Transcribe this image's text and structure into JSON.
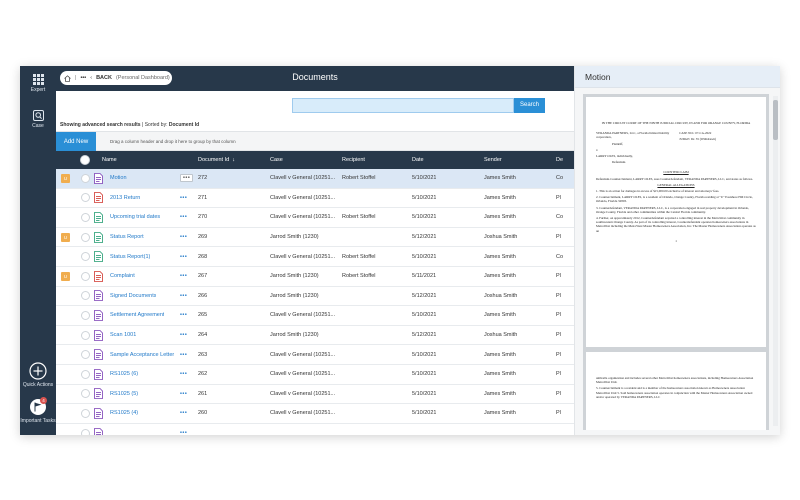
{
  "rail": {
    "expert_label": "Expert",
    "case_label": "Case",
    "quick_actions_label": "Quick Actions",
    "important_tasks_label": "Important Tasks",
    "important_tasks_count": "4"
  },
  "header": {
    "back_label": "BACK",
    "back_sub": "(Personal Dashboard)",
    "title": "Documents"
  },
  "search": {
    "placeholder": "",
    "button_label": "Search"
  },
  "info": {
    "showing": "Showing advanced search results",
    "sorted_by_label": "Sorted by:",
    "sorted_by_value": "Document Id"
  },
  "toolbar": {
    "add_new_label": "Add New",
    "drag_hint": "Drag a column header and drop it here to group by that column"
  },
  "grid": {
    "columns": [
      "Name",
      "Document Id",
      "Case",
      "Recipient",
      "Date",
      "Sender",
      "De"
    ],
    "sort_indicator": "↓",
    "rows": [
      {
        "flag": "U",
        "name": "Motion",
        "id": "272",
        "case": "Clavell v General (10251...",
        "recipient": "Robert Stoffel",
        "date": "5/10/2021",
        "sender": "James Smith",
        "de": "Co",
        "icon": "word",
        "selected": true
      },
      {
        "flag": "",
        "name": "2013 Return",
        "id": "271",
        "case": "Clavell v General (10251...",
        "recipient": "",
        "date": "5/10/2021",
        "sender": "James Smith",
        "de": "Pl",
        "icon": "pdf"
      },
      {
        "flag": "",
        "name": "Upcoming trial dates",
        "id": "270",
        "case": "Clavell v General (10251...",
        "recipient": "Robert Stoffel",
        "date": "5/10/2021",
        "sender": "James Smith",
        "de": "Co",
        "icon": "excel"
      },
      {
        "flag": "U",
        "name": "Status Report",
        "id": "269",
        "case": "Jarrod Smith (1230)",
        "recipient": "",
        "date": "5/12/2021",
        "sender": "Joshua Smith",
        "de": "Pl",
        "icon": "excel"
      },
      {
        "flag": "",
        "name": "Status Report(1)",
        "id": "268",
        "case": "Clavell v General (10251...",
        "recipient": "Robert Stoffel",
        "date": "5/10/2021",
        "sender": "James Smith",
        "de": "Co",
        "icon": "excel"
      },
      {
        "flag": "U",
        "name": "Complaint",
        "id": "267",
        "case": "Jarrod Smith (1230)",
        "recipient": "Robert Stoffel",
        "date": "5/11/2021",
        "sender": "James Smith",
        "de": "Pl",
        "icon": "pdf"
      },
      {
        "flag": "",
        "name": "Signed Documents",
        "id": "266",
        "case": "Jarrod Smith (1230)",
        "recipient": "",
        "date": "5/12/2021",
        "sender": "Joshua Smith",
        "de": "Pl",
        "icon": "word"
      },
      {
        "flag": "",
        "name": "Settlement Agreement",
        "id": "265",
        "case": "Clavell v General (10251...",
        "recipient": "",
        "date": "5/10/2021",
        "sender": "James Smith",
        "de": "Pl",
        "icon": "word"
      },
      {
        "flag": "",
        "name": "Scan 1001",
        "id": "264",
        "case": "Jarrod Smith (1230)",
        "recipient": "",
        "date": "5/12/2021",
        "sender": "Joshua Smith",
        "de": "Pl",
        "icon": "word"
      },
      {
        "flag": "",
        "name": "Sample Acceptance Letter",
        "id": "263",
        "case": "Clavell v General (10251...",
        "recipient": "",
        "date": "5/10/2021",
        "sender": "James Smith",
        "de": "Pl",
        "icon": "word"
      },
      {
        "flag": "",
        "name": "RS1025 (6)",
        "id": "262",
        "case": "Clavell v General (10251...",
        "recipient": "",
        "date": "5/10/2021",
        "sender": "James Smith",
        "de": "Pl",
        "icon": "word"
      },
      {
        "flag": "",
        "name": "RS1025 (5)",
        "id": "261",
        "case": "Clavell v General (10251...",
        "recipient": "",
        "date": "5/10/2021",
        "sender": "James Smith",
        "de": "Pl",
        "icon": "word"
      },
      {
        "flag": "",
        "name": "RS1025 (4)",
        "id": "260",
        "case": "Clavell v General (10251...",
        "recipient": "",
        "date": "5/10/2021",
        "sender": "James Smith",
        "de": "Pl",
        "icon": "word"
      },
      {
        "flag": "",
        "name": "",
        "id": "",
        "case": "",
        "recipient": "",
        "date": "",
        "sender": "",
        "de": "",
        "icon": "word"
      }
    ]
  },
  "row_menu": "•••",
  "docpane": {
    "title": "Motion",
    "page1": {
      "court": "IN THE CIRCUIT COURT OF THE NINTH JUDICIAL CIRCUIT, IN AND FOR ORANGE COUNTY, FLORIDA",
      "party1": "VERANDA PARTNERS, LLC, a Florida limited liability corporation,",
      "plaintiff": "Plaintiff,",
      "vs": "v.",
      "case_no": "CASE NO.: 07-CA-2022",
      "judge": "JUDGE: Dr. 35 (Withdrawn)",
      "party2": "LARRY OLES, individually,",
      "defendant": "Defendant.",
      "intro": "Defendant-Counterclaimant, LARRY OLES, sues Counterdefendant, VERANDA PARTNERS, LLC, and states as follows.",
      "heading1": "COUNTERCLAIM",
      "heading2": "GENERAL ALLEGATIONS",
      "p1": "1.    This is an action for damages in excess of $15,000.00 exclusive of interest and attorneys' fees.",
      "p2": "2.    Counterclaimant, LARRY OLES, is a resident of Orlando, Orange County, Florida residing at \"U\" Eastshore Hill Circle, Orlando, Florida 32803.",
      "p3": "3.    Counterdefendant, VERANDA PARTNERS, LLC, is a corporation engaged in real property development in Orlando, Orange County, Florida and other communities within the Central Florida community.",
      "p4": "4.    Further, on approximately 2012, Counterdefendant acquired a controlling interest in the MetroWest community in southwestern Orange County. As part of its controlling interest, Counterdefendant operates homeowners associations in MetroWest including the MetroWest Master Homeowners Association, Inc. The Master Homeowners Association operates as an",
      "page_number": "1"
    },
    "page2": {
      "p1": "umbrella organization and includes several other MetroWest homeowners associations, including Homeowners Association MetroWest Unit.",
      "p2": "5.    Counterclaimant is a resident and is a member of the homeowners association known as Homeowners Association MetroWest Unit 5. Said homeowners association operates in conjunction with the Master Homeowners Association owned and/or operated by VERANDA PARTNERS, LLC"
    }
  },
  "colors": {
    "rail": "#27384a",
    "accent": "#2a8fd6",
    "flag": "#f0ad4e",
    "link": "#1f78c8",
    "selected_row": "#dbe7f5"
  }
}
